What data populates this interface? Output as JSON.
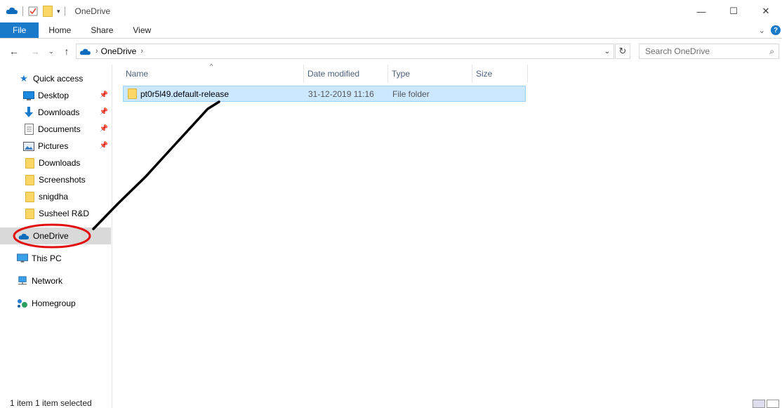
{
  "window": {
    "title": "OneDrive",
    "controls": {
      "minimize": "—",
      "maximize": "☐",
      "close": "✕"
    }
  },
  "ribbon": {
    "tabs": [
      "File",
      "Home",
      "Share",
      "View"
    ]
  },
  "navigation": {
    "address": {
      "location": "OneDrive"
    },
    "search_placeholder": "Search OneDrive"
  },
  "nav_pane": {
    "quick_access": "Quick access",
    "items": [
      {
        "label": "Desktop",
        "pinned": true,
        "icon": "desktop-icon"
      },
      {
        "label": "Downloads",
        "pinned": true,
        "icon": "download-arrow-icon"
      },
      {
        "label": "Documents",
        "pinned": true,
        "icon": "documents-icon"
      },
      {
        "label": "Pictures",
        "pinned": true,
        "icon": "pictures-icon"
      },
      {
        "label": "Downloads",
        "pinned": false,
        "icon": "folder-icon"
      },
      {
        "label": "Screenshots",
        "pinned": false,
        "icon": "folder-icon"
      },
      {
        "label": "snigdha",
        "pinned": false,
        "icon": "folder-icon"
      },
      {
        "label": "Susheel R&D",
        "pinned": false,
        "icon": "folder-icon"
      }
    ],
    "onedrive": "OneDrive",
    "this_pc": "This PC",
    "network": "Network",
    "homegroup": "Homegroup"
  },
  "content": {
    "columns": [
      "Name",
      "Date modified",
      "Type",
      "Size"
    ],
    "rows": [
      {
        "name": "pt0r5l49.default-release",
        "date": "31-12-2019 11:16",
        "type": "File folder",
        "size": ""
      }
    ]
  },
  "status": {
    "text": "1 item    1 item selected"
  },
  "colors": {
    "accent": "#1979ca",
    "selection": "#cce8ff",
    "annotation_circle": "#e01010"
  }
}
